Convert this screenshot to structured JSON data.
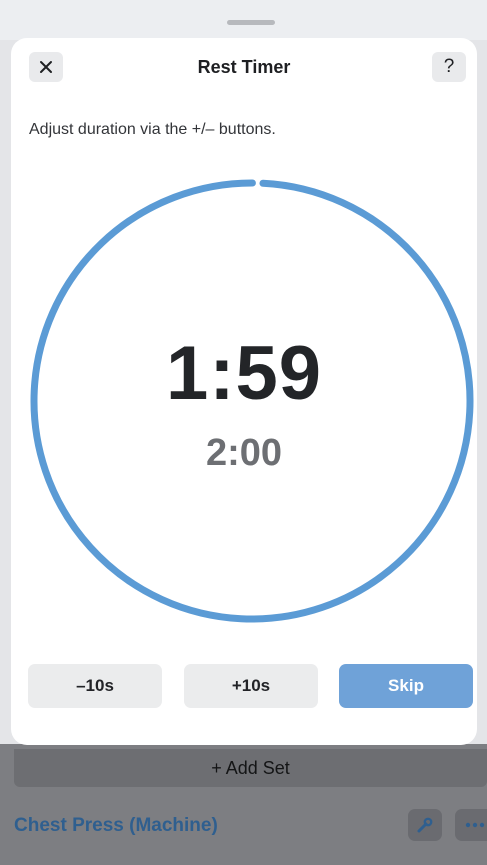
{
  "sheet": {
    "title": "Rest Timer",
    "close_icon": "close-icon",
    "help_label": "?",
    "instructions": "Adjust duration via the +/– buttons."
  },
  "timer": {
    "remaining": "1:59",
    "total": "2:00",
    "progress_fraction": 0.992,
    "ring_color": "#5b9bd5"
  },
  "controls": {
    "minus_label": "–10s",
    "plus_label": "+10s",
    "skip_label": "Skip",
    "skip_color": "#6fa2d8"
  },
  "background": {
    "add_set_label": "+ Add Set",
    "exercise_name": "Chest Press (Machine)",
    "edit_icon": "wrench-icon",
    "more_icon": "more-horizontal-icon"
  }
}
